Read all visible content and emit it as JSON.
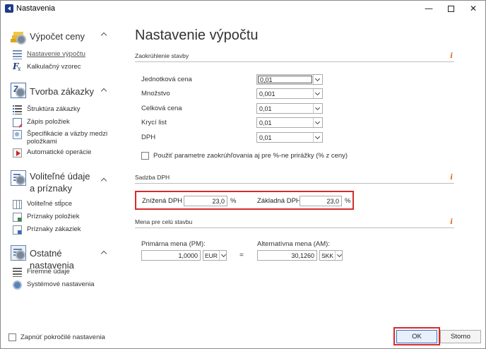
{
  "window": {
    "title": "Nastavenia"
  },
  "sidebar": {
    "sections": [
      {
        "title": "Výpočet ceny",
        "icon": "coins-gear-icon",
        "items": [
          {
            "label": "Nastavenie výpočtu",
            "icon": "table-icon",
            "active": true
          },
          {
            "label": "Kalkulačný vzorec",
            "icon": "fx-icon"
          }
        ]
      },
      {
        "title": "Tvorba zákazky",
        "icon": "order-doc-icon",
        "items": [
          {
            "label": "Štruktúra zákazky",
            "icon": "list-icon"
          },
          {
            "label": "Zápis položiek",
            "icon": "edit-icon"
          },
          {
            "label": "Špecifikácie a väzby medzi položkami",
            "icon": "spec-icon"
          },
          {
            "label": "Automatické operácie",
            "icon": "play-icon"
          }
        ]
      },
      {
        "title": "Voliteľné údaje a príznaky",
        "icon": "form-gear-icon",
        "items": [
          {
            "label": "Voliteľné stĺpce",
            "icon": "columns-icon"
          },
          {
            "label": "Príznaky položiek",
            "icon": "flag-icon"
          },
          {
            "label": "Príznaky zákaziek",
            "icon": "flag-icon"
          }
        ]
      },
      {
        "title": "Ostatné nastavenia",
        "icon": "card-gear-icon",
        "items": [
          {
            "label": "Firemné údaje",
            "icon": "company-icon"
          },
          {
            "label": "Systémové nastavenia",
            "icon": "system-gear-icon"
          }
        ]
      }
    ],
    "advanced_label": "Zapnúť pokročilé nastavenia"
  },
  "main": {
    "title": "Nastavenie výpočtu",
    "rounding": {
      "header": "Zaokrúhlenie stavby",
      "rows": [
        {
          "label": "Jednotková cena",
          "value": "0,01"
        },
        {
          "label": "Množstvo",
          "value": "0,001"
        },
        {
          "label": "Celková cena",
          "value": "0,01"
        },
        {
          "label": "Krycí list",
          "value": "0,01"
        },
        {
          "label": "DPH",
          "value": "0,01"
        }
      ],
      "checkbox_label": "Použiť parametre zaokrúhľovania aj pre %-ne prirážky (% z ceny)"
    },
    "vat": {
      "header": "Sadzba DPH",
      "reduced_label": "Znížená DPH",
      "reduced_value": "23,0",
      "basic_label": "Základná DPH",
      "basic_value": "23,0",
      "unit": "%"
    },
    "currency": {
      "header": "Mena pre celú stavbu",
      "primary_label": "Primárna mena (PM):",
      "primary_value": "1,0000",
      "primary_currency": "EUR",
      "equals": "=",
      "alt_label": "Alternatívna mena (AM):",
      "alt_value": "30,1260",
      "alt_currency": "SKK"
    }
  },
  "buttons": {
    "ok": "OK",
    "cancel": "Storno"
  },
  "colors": {
    "highlight": "#d62b2b",
    "info": "#e06a1a"
  }
}
